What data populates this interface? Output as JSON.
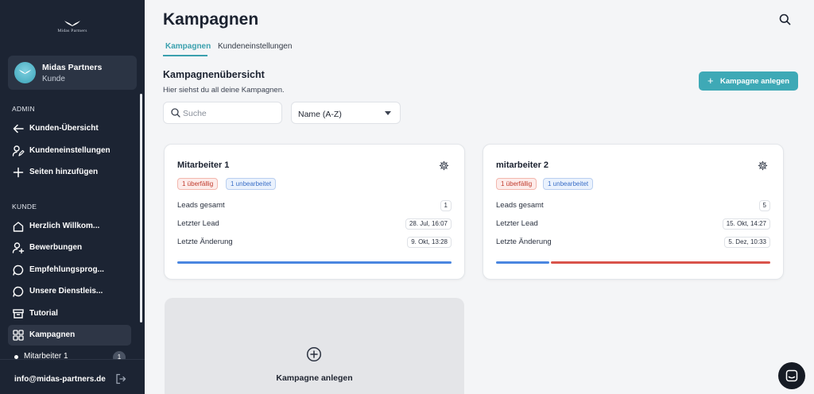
{
  "sidebar": {
    "logo_text": "Midas Partners",
    "account": {
      "name": "Midas Partners",
      "role": "Kunde"
    },
    "admin_label": "ADMIN",
    "admin_items": [
      {
        "label": "Kunden-Übersicht",
        "icon": "arrow-left-icon"
      },
      {
        "label": "Kundeneinstellungen",
        "icon": "user-settings-icon"
      },
      {
        "label": "Seiten hinzufügen",
        "icon": "plus-icon"
      }
    ],
    "kunde_label": "KUNDE",
    "kunde_items": [
      {
        "label": "Herzlich Willkom...",
        "icon": "home-icon"
      },
      {
        "label": "Bewerbungen",
        "icon": "user-plus-icon"
      },
      {
        "label": "Empfehlungsprog...",
        "icon": "chat-bubble-icon"
      },
      {
        "label": "Unsere Dienstleis...",
        "icon": "chat-bubble-icon"
      },
      {
        "label": "Tutorial",
        "icon": "archive-icon"
      },
      {
        "label": "Kampagnen",
        "icon": "grid-icon",
        "active": true
      }
    ],
    "sub_item": {
      "label": "Mitarbeiter 1",
      "count": "1"
    },
    "footer_email": "info@midas-partners.de"
  },
  "header": {
    "title": "Kampagnen"
  },
  "tabs": [
    {
      "label": "Kampagnen",
      "active": true
    },
    {
      "label": "Kundeneinstellungen",
      "active": false
    }
  ],
  "overview": {
    "title": "Kampagnenübersicht",
    "subtitle": "Hier siehst du all deine Kampagnen.",
    "create_button": "Kampagne anlegen"
  },
  "filters": {
    "search_placeholder": "Suche",
    "sort_value": "Name (A-Z)"
  },
  "stat_labels": {
    "leads": "Leads gesamt",
    "last_lead": "Letzter Lead",
    "last_change": "Letzte Änderung"
  },
  "campaigns": [
    {
      "name": "Mitarbeiter 1",
      "badge_overdue": "1 überfällig",
      "badge_unprocessed": "1 unbearbeitet",
      "leads_total": "1",
      "last_lead": "28. Jul, 16:07",
      "last_change": "9. Okt, 13:28",
      "progress": {
        "blue_fraction": 1.0,
        "red_fraction": 0.0
      }
    },
    {
      "name": "mitarbeiter 2",
      "badge_overdue": "1 überfällig",
      "badge_unprocessed": "1 unbearbeitet",
      "leads_total": "5",
      "last_lead": "15. Okt, 14:27",
      "last_change": "5. Dez, 10:33",
      "progress": {
        "blue_fraction": 0.2,
        "red_fraction": 0.8
      }
    }
  ],
  "create_card": {
    "label": "Kampagne anlegen"
  },
  "colors": {
    "sidebar_bg": "#1c2433",
    "accent": "#3ea9b6",
    "bar_blue": "#4a86e0",
    "bar_red": "#d9534a"
  }
}
